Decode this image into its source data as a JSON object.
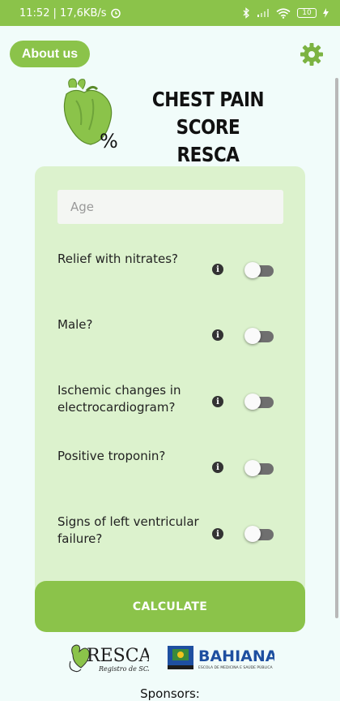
{
  "status_bar": {
    "time": "11:52",
    "network_speed": "| 17,6KB/s",
    "battery_level": "10"
  },
  "header": {
    "about_label": "About us",
    "title_line1": "CHEST PAIN SCORE",
    "title_line2": "RESCA"
  },
  "form": {
    "age_placeholder": "Age",
    "questions": [
      {
        "label": "Relief with nitrates?",
        "checked": false
      },
      {
        "label": "Male?",
        "checked": false
      },
      {
        "label": "Ischemic changes in electrocardiogram?",
        "checked": false
      },
      {
        "label": "Positive troponin?",
        "checked": false
      },
      {
        "label": "Signs of left ventricular failure?",
        "checked": false
      }
    ],
    "calculate_label": "CALCULATE"
  },
  "sponsors": {
    "label": "Sponsors:",
    "resca_logo_text": "RESCA",
    "resca_logo_subtext": "Registro de SCA",
    "bahiana_logo_text": "BAHIANA",
    "bahiana_logo_subtext": "ESCOLA DE MEDICINA E SAÚDE PÚBLICA"
  },
  "colors": {
    "brand_green": "#8bc34a",
    "card_background": "#dcf2cd",
    "page_background": "#f1fcfa"
  }
}
